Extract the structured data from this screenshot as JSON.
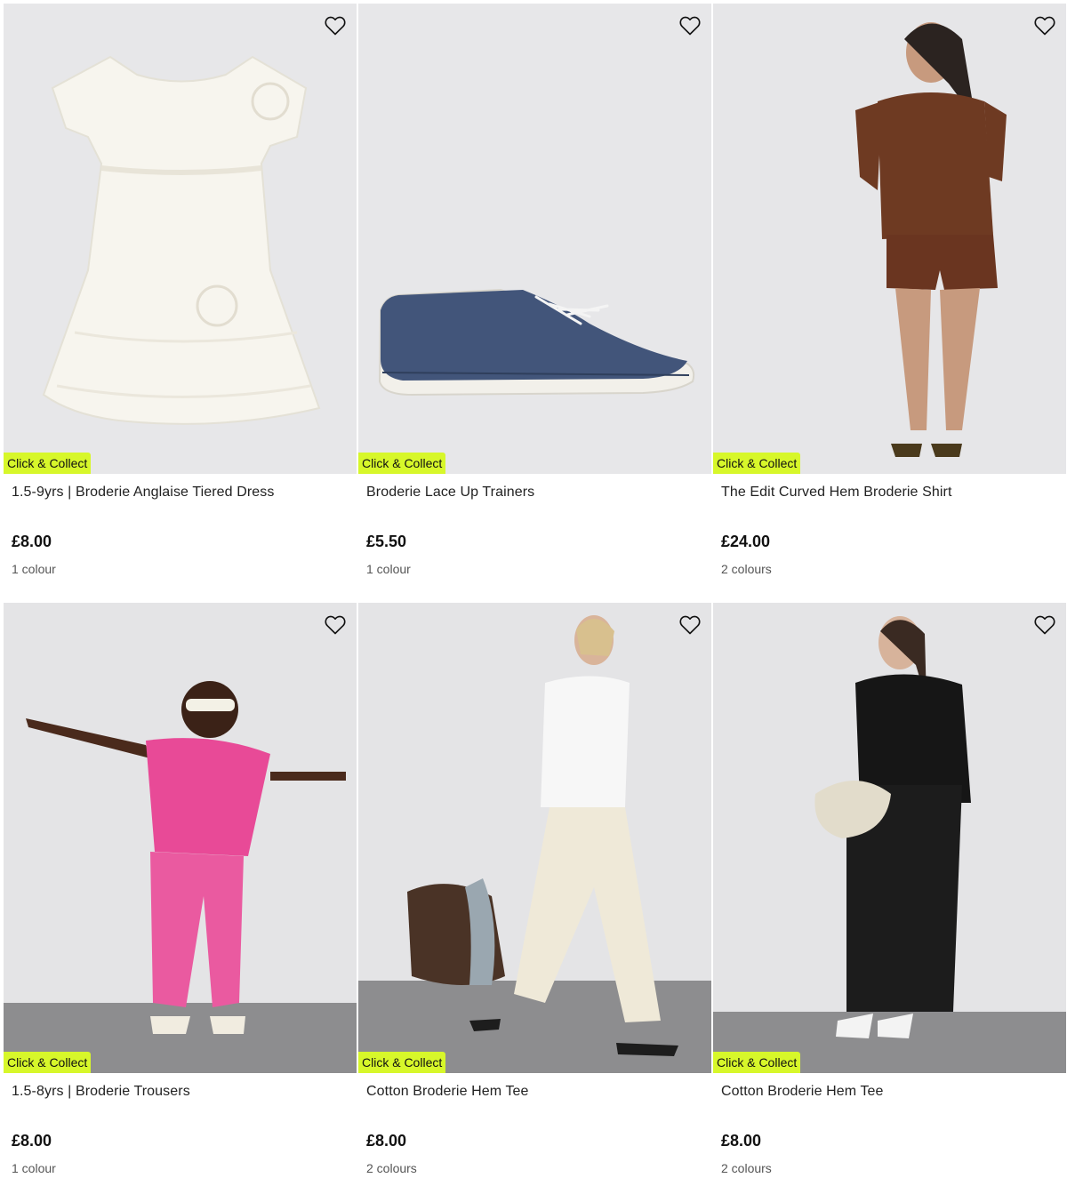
{
  "colors": {
    "badge_bg": "#d7f72a",
    "card_bg": "#e6e6e8"
  },
  "products": [
    {
      "badge": "Click & Collect",
      "name": "1.5-9yrs | Broderie Anglaise Tiered Dress",
      "price": "£8.00",
      "colours": "1 colour",
      "icon": "heart-outline-icon"
    },
    {
      "badge": "Click & Collect",
      "name": "Broderie Lace Up Trainers",
      "price": "£5.50",
      "colours": "1 colour",
      "icon": "heart-outline-icon"
    },
    {
      "badge": "Click & Collect",
      "name": "The Edit Curved Hem Broderie Shirt",
      "price": "£24.00",
      "colours": "2 colours",
      "icon": "heart-outline-icon"
    },
    {
      "badge": "Click & Collect",
      "name": "1.5-8yrs | Broderie Trousers",
      "price": "£8.00",
      "colours": "1 colour",
      "icon": "heart-outline-icon"
    },
    {
      "badge": "Click & Collect",
      "name": "Cotton Broderie Hem Tee",
      "price": "£8.00",
      "colours": "2 colours",
      "icon": "heart-outline-icon"
    },
    {
      "badge": "Click & Collect",
      "name": "Cotton Broderie Hem Tee",
      "price": "£8.00",
      "colours": "2 colours",
      "icon": "heart-outline-icon"
    }
  ]
}
